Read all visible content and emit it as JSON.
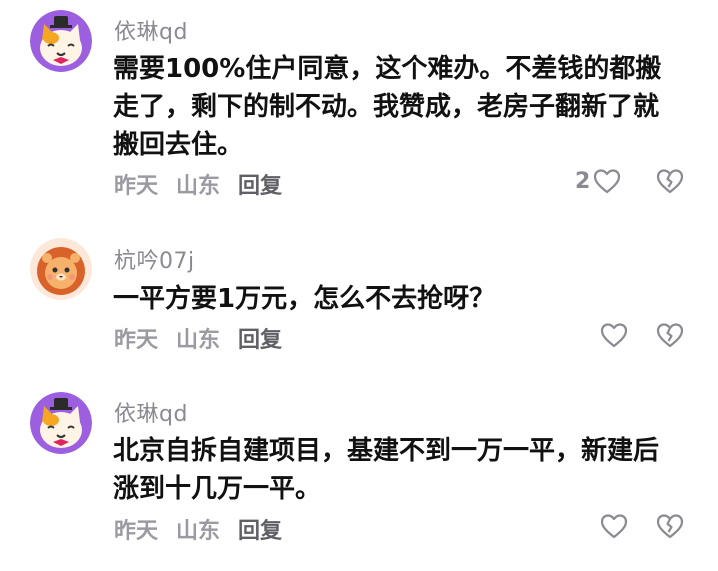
{
  "comments": [
    {
      "username": "依琳qd",
      "text": "需要100%住户同意，这个难办。不差钱的都搬走了，剩下的制不动。我赞成，老房子翻新了就搬回去住。",
      "time": "昨天",
      "location": "山东",
      "reply_label": "回复",
      "like_count": "2",
      "avatar_icon": "cat-avatar-icon"
    },
    {
      "username": "杭吟07j",
      "text": "一平方要1万元，怎么不去抢呀？",
      "time": "昨天",
      "location": "山东",
      "reply_label": "回复",
      "like_count": "",
      "avatar_icon": "lion-avatar-icon"
    },
    {
      "username": "依琳qd",
      "text": "北京自拆自建项目，基建不到一万一平，新建后涨到十几万一平。",
      "time": "昨天",
      "location": "山东",
      "reply_label": "回复",
      "like_count": "",
      "avatar_icon": "cat-avatar-icon"
    }
  ],
  "icons": {
    "like": "heart-icon",
    "dislike": "broken-heart-icon"
  },
  "colors": {
    "username": "#8a8a92",
    "text": "#111111",
    "meta": "#9a9aa2"
  }
}
